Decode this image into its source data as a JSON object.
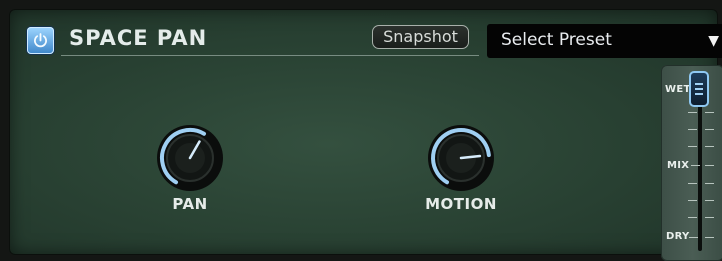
{
  "plugin": {
    "title": "SPACE PAN",
    "snapshot_label": "Snapshot",
    "preset_label": "Select Preset",
    "power_icon": "power-icon",
    "dropdown_icon": "triangle-down-icon"
  },
  "knobs": [
    {
      "label": "PAN",
      "value": 0.6
    },
    {
      "label": "MOTION",
      "value": 0.78
    }
  ],
  "mix": {
    "wet_label": "WET",
    "mix_label": "MIX",
    "dry_label": "DRY",
    "level": 1.0
  },
  "colors": {
    "accent": "#8fc8f2",
    "panel": "#2a4334",
    "preset_bg": "#040404"
  }
}
